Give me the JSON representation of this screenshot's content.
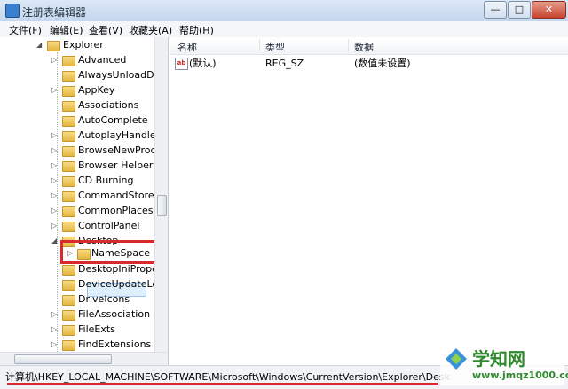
{
  "window": {
    "title": "注册表编辑器"
  },
  "window_buttons": {
    "minimize": "—",
    "maximize": "□",
    "close": "✕"
  },
  "menu": [
    "文件(F)",
    "编辑(E)",
    "查看(V)",
    "收藏夹(A)",
    "帮助(H)"
  ],
  "tree": {
    "parent": "Explorer",
    "items": [
      {
        "label": "Advanced"
      },
      {
        "label": "AlwaysUnloadDLL"
      },
      {
        "label": "AppKey"
      },
      {
        "label": "Associations"
      },
      {
        "label": "AutoComplete"
      },
      {
        "label": "AutoplayHandlers"
      },
      {
        "label": "BrowseNewProce"
      },
      {
        "label": "Browser Helper C"
      },
      {
        "label": "CD Burning"
      },
      {
        "label": "CommandStore"
      },
      {
        "label": "CommonPlaces"
      },
      {
        "label": "ControlPanel"
      },
      {
        "label": "Desktop"
      },
      {
        "label": "NameSpace"
      },
      {
        "label": "DesktopIniProper"
      },
      {
        "label": "DeviceUpdateLoca"
      },
      {
        "label": "DriveIcons"
      },
      {
        "label": "FileAssociation"
      },
      {
        "label": "FileExts"
      },
      {
        "label": "FindExtensions"
      }
    ]
  },
  "list": {
    "headers": {
      "name": "名称",
      "type": "类型",
      "data": "数据"
    },
    "rows": [
      {
        "name": "(默认)",
        "type": "REG_SZ",
        "data": "(数值未设置)"
      }
    ]
  },
  "statusbar": {
    "path": "计算机\\HKEY_LOCAL_MACHINE\\SOFTWARE\\Microsoft\\Windows\\CurrentVersion\\Explorer\\Desktop\\NameSpace"
  },
  "watermark": {
    "title": "学知网",
    "url": "www.jmqz1000.com"
  },
  "colors": {
    "annotation_red": "#d82a2a",
    "watermark_green": "#2f8a2e"
  }
}
